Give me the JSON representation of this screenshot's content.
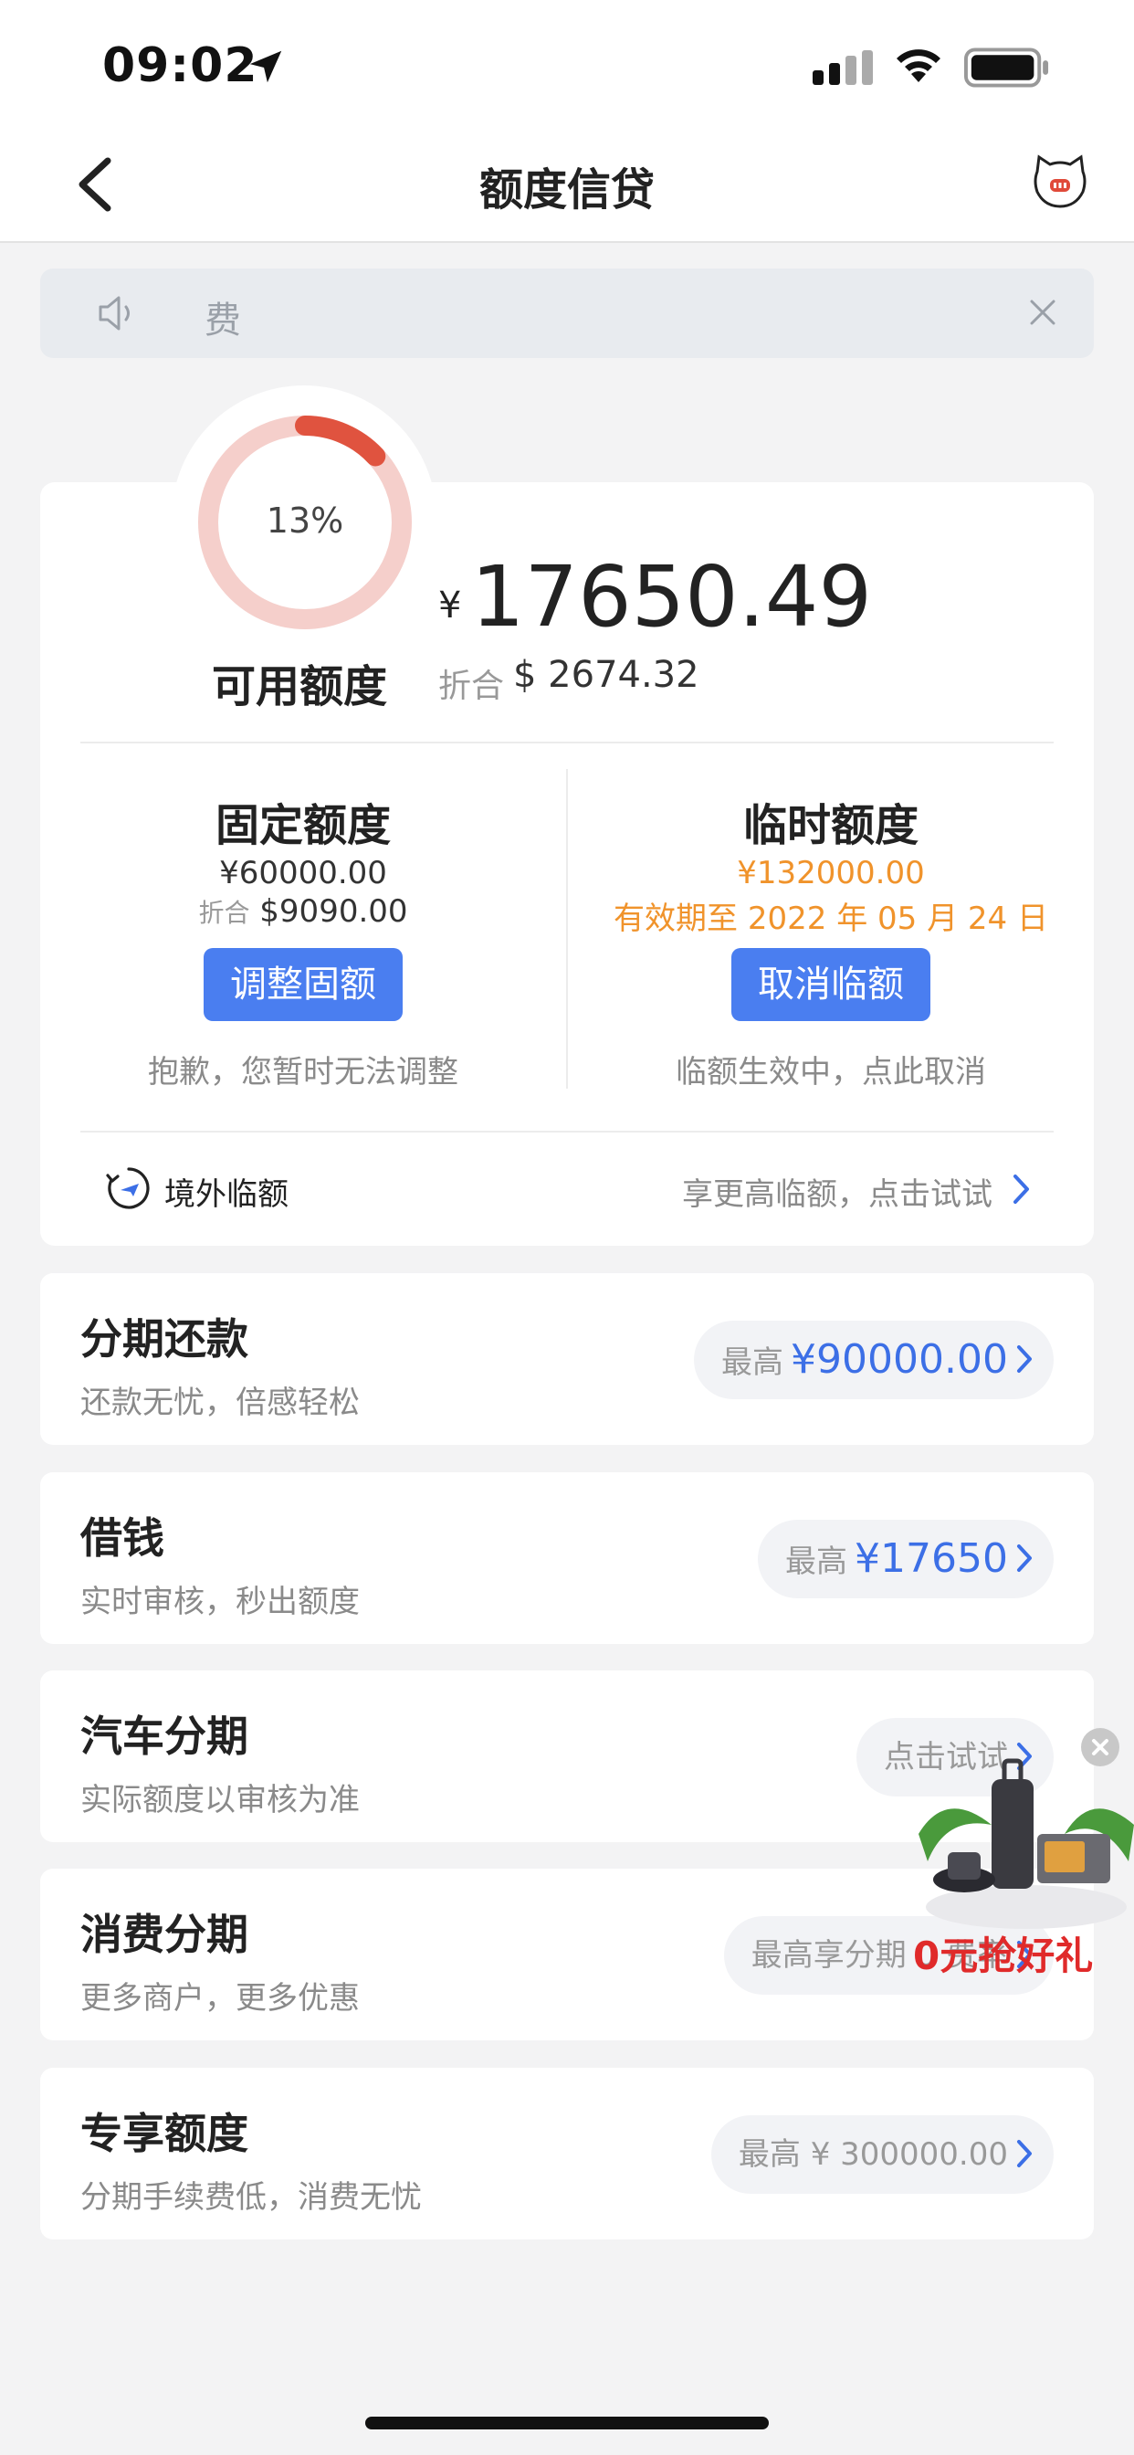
{
  "status_bar": {
    "time": "09:02"
  },
  "nav": {
    "title": "额度信贷"
  },
  "notice": {
    "text": "费"
  },
  "credit": {
    "usage_percent_label": "13%",
    "usage_fraction": 0.13,
    "available_label": "可用额度",
    "currency_symbol": "¥",
    "available_amount": "17650.49",
    "converted_label": "折合",
    "converted_value": "$ 2674.32",
    "fixed": {
      "title": "固定额度",
      "amount": "¥60000.00",
      "converted_label": "折合",
      "converted_value": "$9090.00",
      "button": "调整固额",
      "note": "抱歉，您暂时无法调整"
    },
    "temp": {
      "title": "临时额度",
      "amount": "¥132000.00",
      "validity": "有效期至 2022 年 05 月 24 日",
      "button": "取消临额",
      "note": "临额生效中，点此取消"
    },
    "overseas": {
      "label": "境外临额",
      "tip": "享更高临额，点击试试"
    }
  },
  "products": [
    {
      "title": "分期还款",
      "subtitle": "还款无忧，倍感轻松",
      "pill_label": "最高",
      "pill_value": "¥90000.00"
    },
    {
      "title": "借钱",
      "subtitle": "实时审核，秒出额度",
      "pill_label": "最高",
      "pill_value": "¥17650"
    },
    {
      "title": "汽车分期",
      "subtitle": "实际额度以审核为准",
      "pill_label": "点击试试",
      "pill_value": ""
    },
    {
      "title": "消费分期",
      "subtitle": "更多商户，更多优惠",
      "pill_label": "最高享分期 0 费率",
      "pill_value": ""
    },
    {
      "title": "专享额度",
      "subtitle": "分期手续费低，消费无忧",
      "pill_label": "最高 ¥ 300000.00",
      "pill_value": ""
    }
  ],
  "promo": {
    "text": "0元抢好礼"
  },
  "colors": {
    "accent": "#4a7ef0",
    "warning": "#f0932b",
    "donut_arc": "#e0533f",
    "donut_track": "#f5cfcb"
  }
}
